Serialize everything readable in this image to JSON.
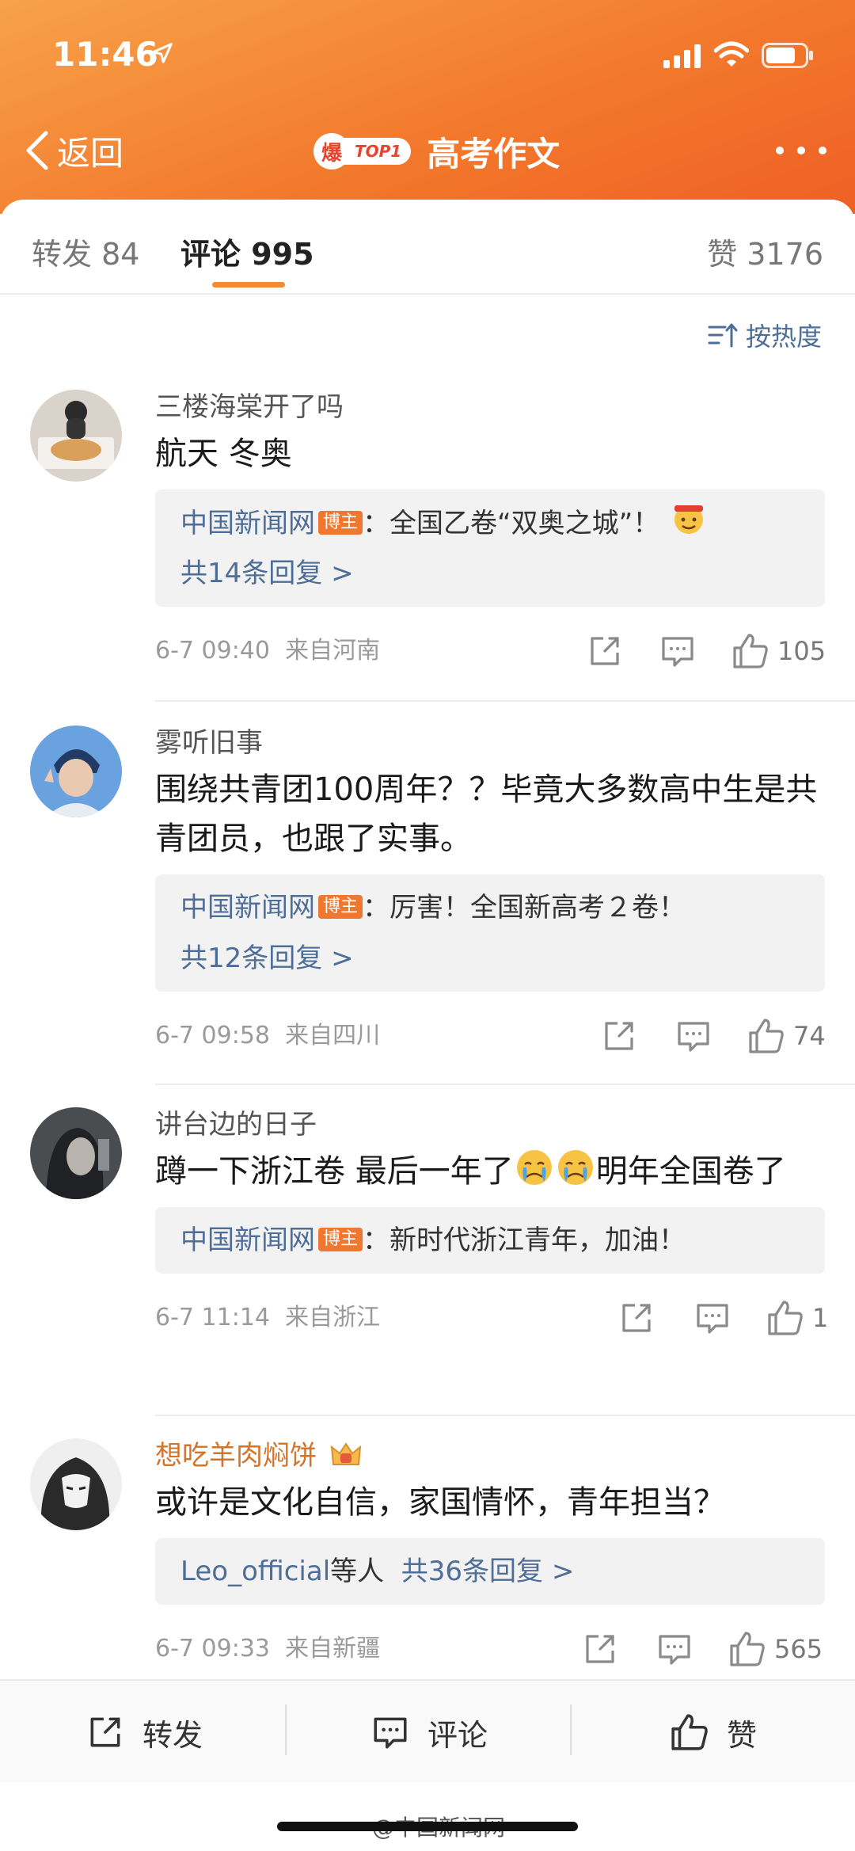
{
  "status_bar": {
    "time": "11:46"
  },
  "nav": {
    "back_label": "返回",
    "title": "高考作文",
    "badge_bao": "爆",
    "badge_top": "TOP1"
  },
  "tabs": {
    "repost": "转发 84",
    "comments": "评论 995",
    "likes": "赞 3176"
  },
  "sort": {
    "label": "按热度"
  },
  "comments": [
    {
      "username": "三楼海棠开了吗",
      "text": "航天 冬奥",
      "reply_author": "中国新闻网",
      "reply_badge": "博主",
      "reply_text": "：全国乙卷“双奥之城”！",
      "reply_count": "共14条回复 >",
      "date": "6-7 09:40",
      "location": "来自河南",
      "likes": "105"
    },
    {
      "username": "雾听旧事",
      "text": "围绕共青团100周年？？毕竟大多数高中生是共青团员，也跟了实事。",
      "reply_author": "中国新闻网",
      "reply_badge": "博主",
      "reply_text": "：厉害！全国新高考２卷！",
      "reply_count": "共12条回复 >",
      "date": "6-7 09:58",
      "location": "来自四川",
      "likes": "74"
    },
    {
      "username": "讲台边的日子",
      "text_a": "蹲一下浙江卷 最后一年了",
      "text_b": "明年全国卷了",
      "reply_author": "中国新闻网",
      "reply_badge": "博主",
      "reply_text": "：新时代浙江青年，加油！",
      "date": "6-7 11:14",
      "location": "来自浙江",
      "likes": "1"
    },
    {
      "username": "想吃羊肉焖饼",
      "text": "或许是文化自信，家国情怀，青年担当？",
      "reply_author": "Leo_official",
      "reply_suffix": "等人",
      "reply_count": "共36条回复 >",
      "date": "6-7 09:33",
      "location": "来自新疆",
      "likes": "565"
    }
  ],
  "toolbar": {
    "repost": "转发",
    "comment": "评论",
    "like": "赞"
  },
  "watermark": "@中国新闻网",
  "colors": {
    "header": "#f37a2c",
    "link": "#4e6e98",
    "badge": "#f0772f",
    "tab_accent": "#f28a36"
  }
}
